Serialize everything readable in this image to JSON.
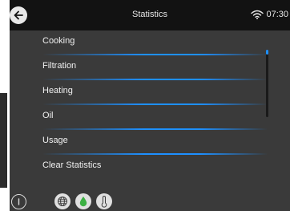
{
  "header": {
    "title": "Statistics",
    "time": "07:30",
    "back_icon": "back-arrow-icon",
    "wifi_icon": "wifi-icon"
  },
  "menu": {
    "items": [
      {
        "label": "Cooking"
      },
      {
        "label": "Filtration"
      },
      {
        "label": "Heating"
      },
      {
        "label": "Oil"
      },
      {
        "label": "Usage"
      },
      {
        "label": "Clear Statistics"
      }
    ]
  },
  "bottom_bar": {
    "icons": [
      "power-icon",
      "globe-icon",
      "oil-drop-icon",
      "thermometer-icon"
    ]
  },
  "colors": {
    "accent": "#1e90ff",
    "header_bg": "#121212",
    "screen_bg": "#3a3a3a",
    "drop_green": "#3cb043"
  }
}
